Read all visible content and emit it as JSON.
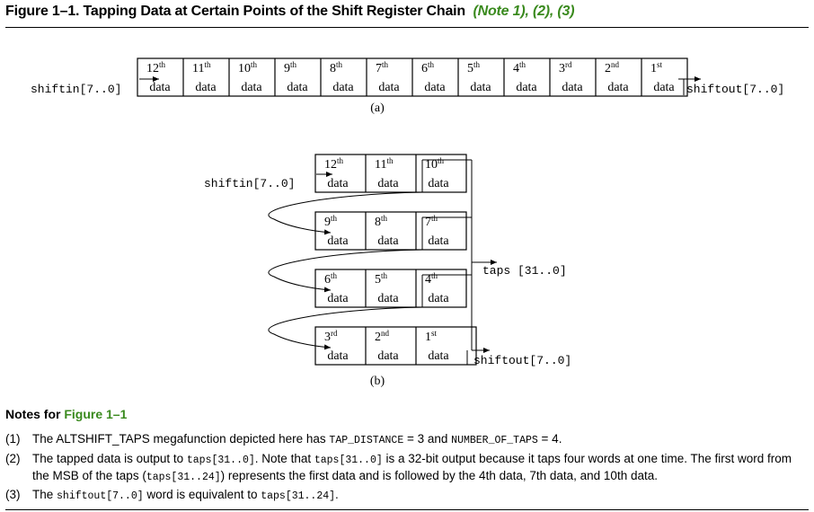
{
  "figure": {
    "title": "Figure 1–1. Tapping Data at Certain Points of the Shift Register Chain",
    "notes_ref": "(Note 1), (2), (3)"
  },
  "diagram_a": {
    "input_label": "shiftin[7..0]",
    "output_label": "shiftout[7..0]",
    "caption": "(a)",
    "cells": [
      {
        "ord": "12",
        "sup": "th",
        "word": "data"
      },
      {
        "ord": "11",
        "sup": "th",
        "word": "data"
      },
      {
        "ord": "10",
        "sup": "th",
        "word": "data"
      },
      {
        "ord": "9",
        "sup": "th",
        "word": "data"
      },
      {
        "ord": "8",
        "sup": "th",
        "word": "data"
      },
      {
        "ord": "7",
        "sup": "th",
        "word": "data"
      },
      {
        "ord": "6",
        "sup": "th",
        "word": "data"
      },
      {
        "ord": "5",
        "sup": "th",
        "word": "data"
      },
      {
        "ord": "4",
        "sup": "th",
        "word": "data"
      },
      {
        "ord": "3",
        "sup": "rd",
        "word": "data"
      },
      {
        "ord": "2",
        "sup": "nd",
        "word": "data"
      },
      {
        "ord": "1",
        "sup": "st",
        "word": "data"
      }
    ]
  },
  "diagram_b": {
    "input_label": "shiftin[7..0]",
    "taps_label": "taps [31..0]",
    "output_label": "shiftout[7..0]",
    "caption": "(b)",
    "rows": [
      [
        {
          "ord": "12",
          "sup": "th",
          "word": "data"
        },
        {
          "ord": "11",
          "sup": "th",
          "word": "data"
        },
        {
          "ord": "10",
          "sup": "th",
          "word": "data"
        }
      ],
      [
        {
          "ord": "9",
          "sup": "th",
          "word": "data"
        },
        {
          "ord": "8",
          "sup": "th",
          "word": "data"
        },
        {
          "ord": "7",
          "sup": "th",
          "word": "data"
        }
      ],
      [
        {
          "ord": "6",
          "sup": "th",
          "word": "data"
        },
        {
          "ord": "5",
          "sup": "th",
          "word": "data"
        },
        {
          "ord": "4",
          "sup": "th",
          "word": "data"
        }
      ],
      [
        {
          "ord": "3",
          "sup": "rd",
          "word": "data"
        },
        {
          "ord": "2",
          "sup": "nd",
          "word": "data"
        },
        {
          "ord": "1",
          "sup": "st",
          "word": "data"
        }
      ]
    ]
  },
  "notes": {
    "heading": "Notes for",
    "heading_ref": "Figure 1–1",
    "items": [
      {
        "num": "(1)",
        "t1": "The ALTSHIFT_TAPS megafunction depicted here has ",
        "c1": "TAP_DISTANCE",
        "t2": " = 3 and ",
        "c2": "NUMBER_OF_TAPS",
        "t3": " = 4."
      },
      {
        "num": "(2)",
        "t1": "The tapped data is output to ",
        "c1": "taps[31..0]",
        "t2": ". Note that ",
        "c2": "taps[31..0]",
        "t3": " is a 32-bit output because it taps four words at one time. The first word from the MSB of the taps (",
        "c3": "taps[31..24]",
        "t4": ") represents the first data and is followed by the 4th data, 7th data, and 10th data."
      },
      {
        "num": "(3)",
        "t1": "The ",
        "c1": "shiftout[7..0]",
        "t2": " word is equivalent to ",
        "c2": "taps[31..24]",
        "t3": "."
      }
    ]
  }
}
